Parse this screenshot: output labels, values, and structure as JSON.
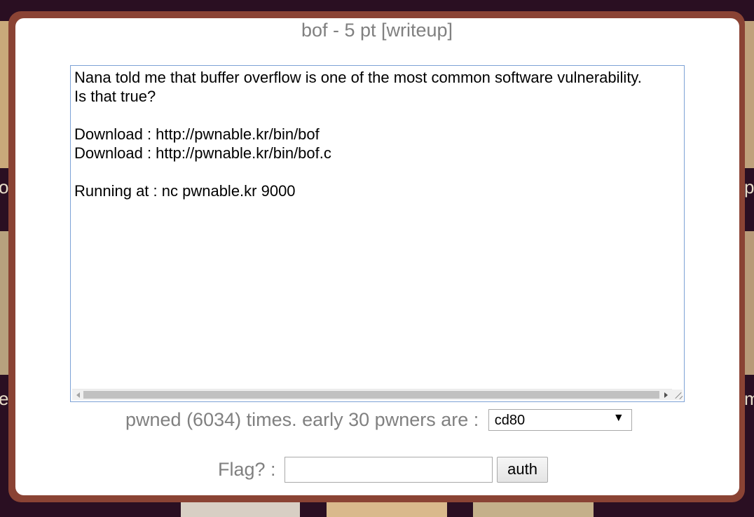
{
  "modal": {
    "title": "bof - 5 pt [writeup]",
    "description_lines": [
      "Nana told me that buffer overflow is one of the most common software vulnerability.",
      "Is that true?",
      "",
      "Download : http://pwnable.kr/bin/bof",
      "Download : http://pwnable.kr/bin/bof.c",
      "",
      "Running at : nc pwnable.kr 9000"
    ],
    "pwned_text": "pwned (6034) times. early 30 pwners are : ",
    "pwners_selected": "cd80",
    "flag_label": "Flag? : ",
    "flag_value": "",
    "auth_label": "auth"
  },
  "background": {
    "left_letters": [
      "o",
      "e"
    ],
    "right_letters": [
      "p",
      "m"
    ]
  },
  "colors": {
    "page_bg": "#2a0f22",
    "modal_border": "#8a4334",
    "muted_text": "#808080",
    "focus_border": "#7da2d6"
  }
}
